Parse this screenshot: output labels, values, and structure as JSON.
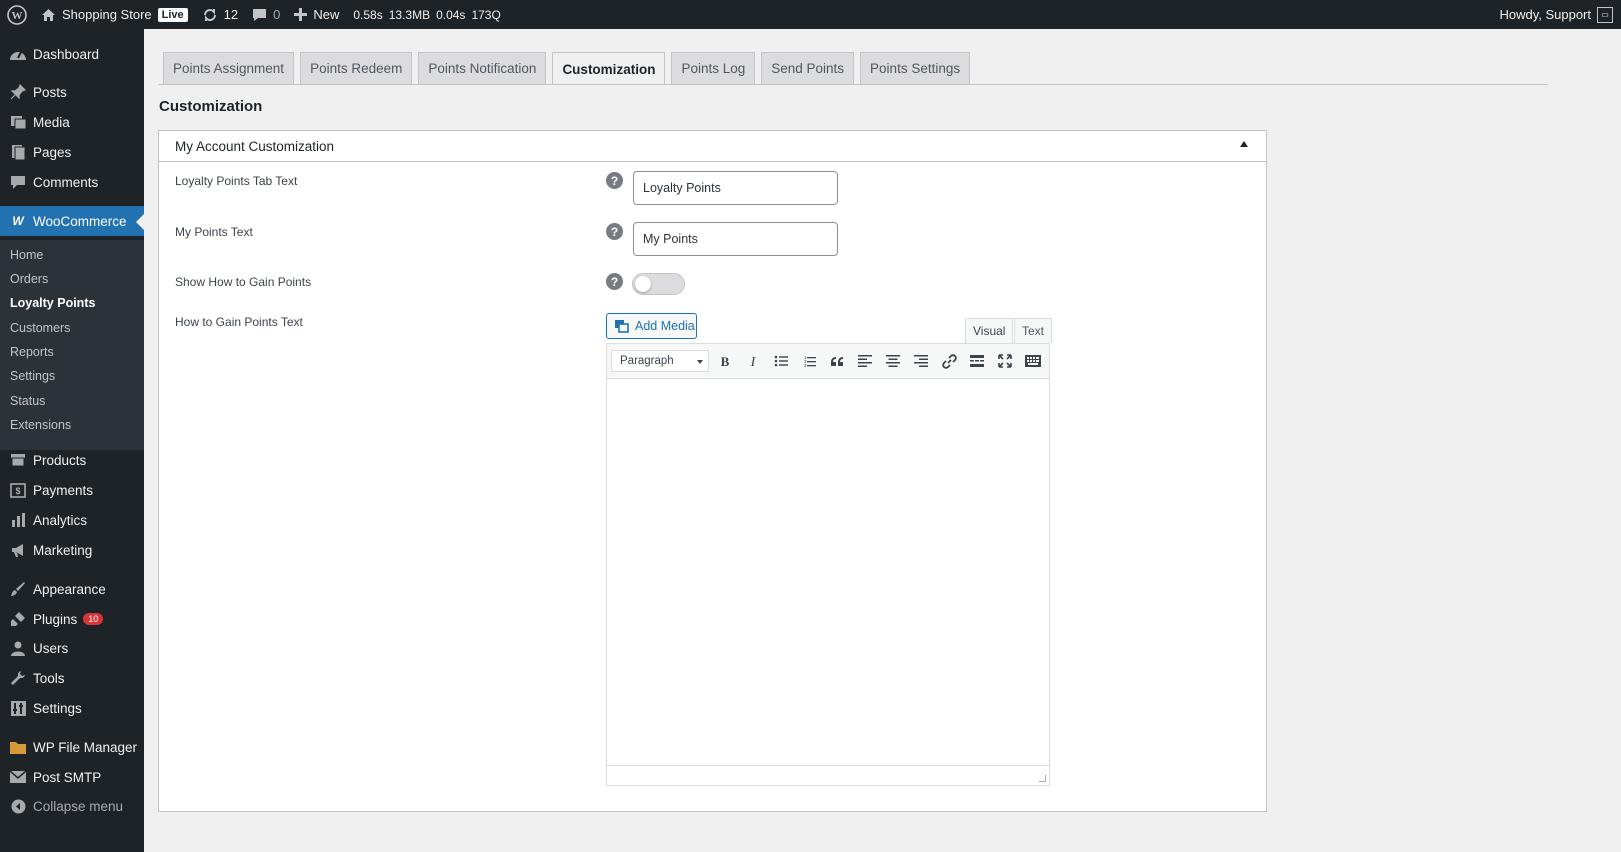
{
  "admin_bar": {
    "site_name": "Shopping Store",
    "live_label": "Live",
    "updates_count": "12",
    "comments_count": "0",
    "new_label": "New",
    "perf_time": "0.58s",
    "perf_memory": "13.3MB",
    "perf_db_time": "0.04s",
    "perf_queries": "173Q",
    "greeting": "Howdy, Support"
  },
  "sidebar": {
    "dashboard": "Dashboard",
    "posts": "Posts",
    "media": "Media",
    "pages": "Pages",
    "comments": "Comments",
    "woocommerce": "WooCommerce",
    "woo_submenu": [
      "Home",
      "Orders",
      "Loyalty Points",
      "Customers",
      "Reports",
      "Settings",
      "Status",
      "Extensions"
    ],
    "products": "Products",
    "payments": "Payments",
    "analytics": "Analytics",
    "marketing": "Marketing",
    "appearance": "Appearance",
    "plugins": "Plugins",
    "plugins_badge": "10",
    "users": "Users",
    "tools": "Tools",
    "settings": "Settings",
    "file_manager": "WP File Manager",
    "post_smtp": "Post SMTP",
    "collapse": "Collapse menu"
  },
  "tabs": [
    "Points Assignment",
    "Points Redeem",
    "Points Notification",
    "Customization",
    "Points Log",
    "Send Points",
    "Points Settings"
  ],
  "active_tab": "Customization",
  "page_title": "Customization",
  "panel": {
    "title": "My Account Customization",
    "fields": {
      "tab_text_label": "Loyalty Points Tab Text",
      "tab_text_value": "Loyalty Points",
      "my_points_label": "My Points Text",
      "my_points_value": "My Points",
      "show_gain_label": "Show How to Gain Points",
      "show_gain_enabled": false,
      "gain_text_label": "How to Gain Points Text"
    },
    "help_glyph": "?",
    "editor": {
      "add_media": "Add Media",
      "tab_visual": "Visual",
      "tab_text": "Text",
      "format_select": "Paragraph",
      "toolbar_icons": [
        "bold-icon",
        "italic-icon",
        "bullet-list-icon",
        "numbered-list-icon",
        "blockquote-icon",
        "align-left-icon",
        "align-center-icon",
        "align-right-icon",
        "link-icon",
        "read-more-icon",
        "fullscreen-icon",
        "toolbar-toggle-icon"
      ]
    }
  },
  "colors": {
    "admin_dark": "#1d2327",
    "accent_blue": "#2271b1",
    "page_bg": "#f0f0f1",
    "badge_red": "#d63638"
  }
}
